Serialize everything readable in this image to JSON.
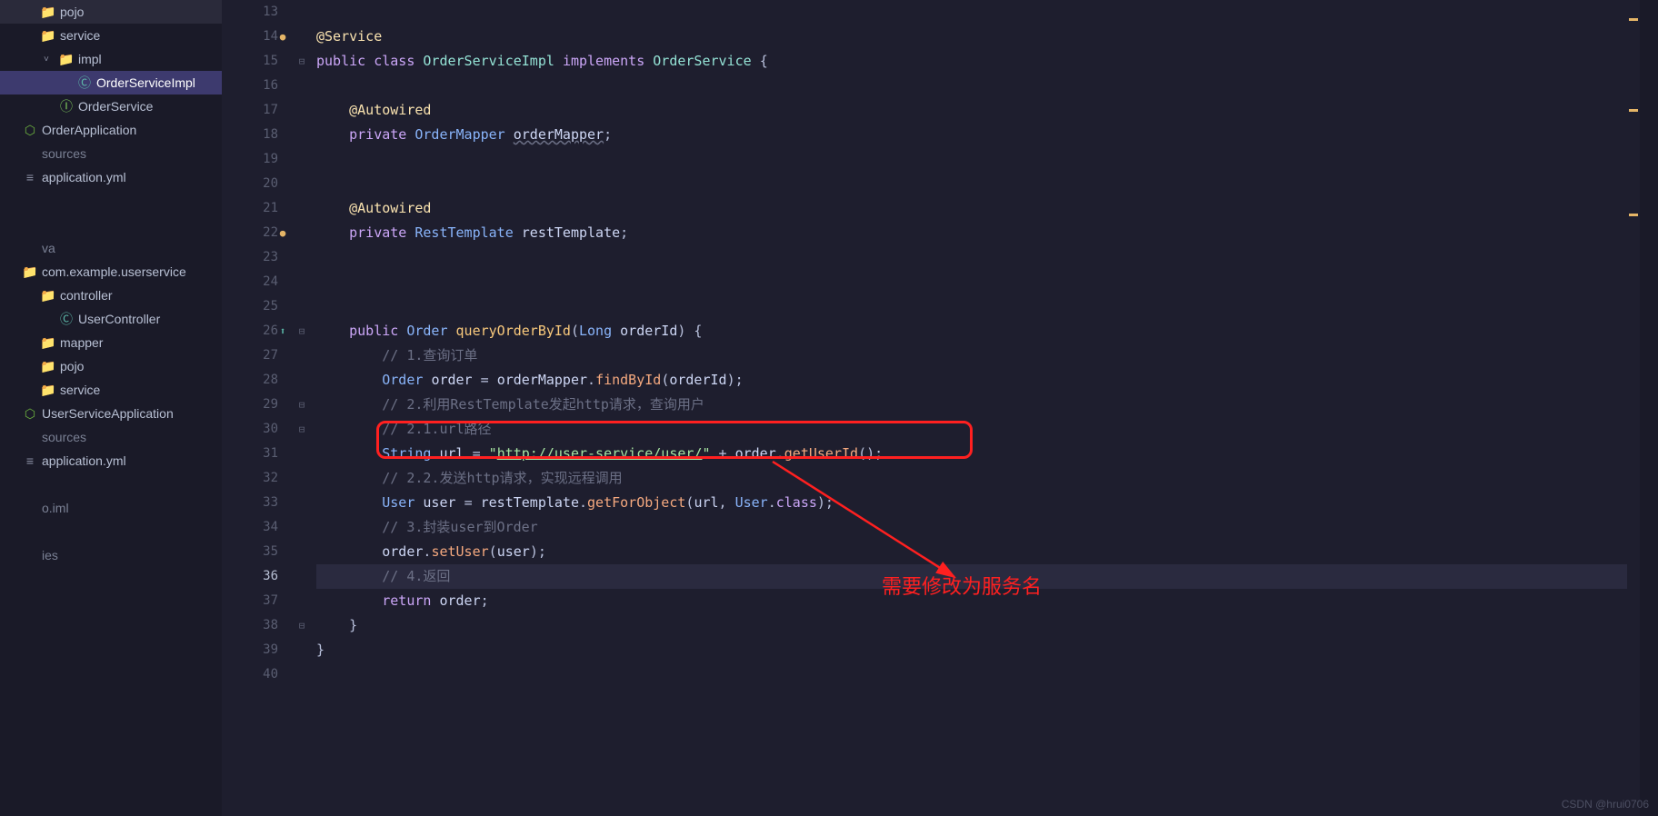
{
  "sidebar": {
    "items": [
      {
        "indent": "pad-1",
        "arrow": "",
        "iconClass": "icon-folder",
        "icon": "📁",
        "label": "pojo"
      },
      {
        "indent": "pad-1",
        "arrow": "",
        "iconClass": "icon-folder-blue",
        "icon": "📁",
        "label": "service"
      },
      {
        "indent": "pad-2",
        "arrow": "˅",
        "iconClass": "icon-folder",
        "icon": "📁",
        "label": "impl"
      },
      {
        "indent": "pad-3",
        "arrow": "",
        "iconClass": "icon-class",
        "icon": "Ⓒ",
        "label": "OrderServiceImpl",
        "selected": true
      },
      {
        "indent": "pad-2",
        "arrow": "",
        "iconClass": "icon-interface",
        "icon": "Ⓘ",
        "label": "OrderService"
      },
      {
        "indent": "",
        "arrow": "",
        "iconClass": "icon-spring",
        "icon": "⬡",
        "label": "OrderApplication"
      },
      {
        "indent": "",
        "arrow": "",
        "iconClass": "",
        "icon": "",
        "label": "sources",
        "dim": true
      },
      {
        "indent": "",
        "arrow": "",
        "iconClass": "icon-yml",
        "icon": "≡",
        "label": "application.yml"
      },
      {
        "indent": "",
        "arrow": "",
        "iconClass": "",
        "icon": "",
        "label": "",
        "dim": true
      },
      {
        "indent": "",
        "arrow": "",
        "iconClass": "",
        "icon": "",
        "label": "",
        "dim": true
      },
      {
        "indent": "",
        "arrow": "",
        "iconClass": "",
        "icon": "",
        "label": "va",
        "dim": true
      },
      {
        "indent": "",
        "arrow": "",
        "iconClass": "icon-folder",
        "icon": "📁",
        "label": "com.example.userservice"
      },
      {
        "indent": "pad-1",
        "arrow": "",
        "iconClass": "icon-folder-blue",
        "icon": "📁",
        "label": "controller"
      },
      {
        "indent": "pad-2",
        "arrow": "",
        "iconClass": "icon-class",
        "icon": "Ⓒ",
        "label": "UserController"
      },
      {
        "indent": "pad-1",
        "arrow": "",
        "iconClass": "icon-folder",
        "icon": "📁",
        "label": "mapper"
      },
      {
        "indent": "pad-1",
        "arrow": "",
        "iconClass": "icon-folder",
        "icon": "📁",
        "label": "pojo"
      },
      {
        "indent": "pad-1",
        "arrow": "",
        "iconClass": "icon-folder-blue",
        "icon": "📁",
        "label": "service"
      },
      {
        "indent": "",
        "arrow": "",
        "iconClass": "icon-spring",
        "icon": "⬡",
        "label": "UserServiceApplication"
      },
      {
        "indent": "",
        "arrow": "",
        "iconClass": "",
        "icon": "",
        "label": "sources",
        "dim": true
      },
      {
        "indent": "",
        "arrow": "",
        "iconClass": "icon-yml",
        "icon": "≡",
        "label": "application.yml"
      },
      {
        "indent": "",
        "arrow": "",
        "iconClass": "",
        "icon": "",
        "label": "",
        "dim": true
      },
      {
        "indent": "",
        "arrow": "",
        "iconClass": "",
        "icon": "",
        "label": "o.iml",
        "dim": true
      },
      {
        "indent": "",
        "arrow": "",
        "iconClass": "",
        "icon": "",
        "label": "",
        "dim": true
      },
      {
        "indent": "",
        "arrow": "",
        "iconClass": "",
        "icon": "",
        "label": "ies",
        "dim": true
      }
    ]
  },
  "gutter": {
    "start": 13,
    "end": 40,
    "current": 36,
    "marks": {
      "14": "bean",
      "22": "bean",
      "26": "override"
    }
  },
  "code": [
    {
      "n": 13,
      "html": ""
    },
    {
      "n": 14,
      "html": "<span class='ann'>@Service</span>"
    },
    {
      "n": 15,
      "html": "<span class='kw'>public</span> <span class='kw'>class</span> <span class='cls'>OrderServiceImpl</span> <span class='kw'>implements</span> <span class='cls'>OrderService</span> <span class='punct'>{</span>"
    },
    {
      "n": 16,
      "html": ""
    },
    {
      "n": 17,
      "html": "    <span class='ann'>@Autowired</span>"
    },
    {
      "n": 18,
      "html": "    <span class='kw'>private</span> <span class='type'>OrderMapper</span> <span class='ident underline'>orderMapper</span><span class='punct'>;</span>"
    },
    {
      "n": 19,
      "html": ""
    },
    {
      "n": 20,
      "html": ""
    },
    {
      "n": 21,
      "html": "    <span class='ann'>@Autowired</span>"
    },
    {
      "n": 22,
      "html": "    <span class='kw'>private</span> <span class='type'>RestTemplate</span> <span class='ident'>restTemplate</span><span class='punct'>;</span>"
    },
    {
      "n": 23,
      "html": ""
    },
    {
      "n": 24,
      "html": ""
    },
    {
      "n": 25,
      "html": ""
    },
    {
      "n": 26,
      "html": "    <span class='kw'>public</span> <span class='type'>Order</span> <span class='fn'>queryOrderById</span><span class='punct'>(</span><span class='type'>Long</span> <span class='ident'>orderId</span><span class='punct'>) {</span>"
    },
    {
      "n": 27,
      "html": "        <span class='cmt'>// 1.查询订单</span>"
    },
    {
      "n": 28,
      "html": "        <span class='type'>Order</span> <span class='ident'>order</span> <span class='punct'>=</span> <span class='ident'>orderMapper</span><span class='punct'>.</span><span class='fn2'>findById</span><span class='punct'>(</span><span class='ident'>orderId</span><span class='punct'>);</span>"
    },
    {
      "n": 29,
      "html": "        <span class='cmt'>// 2.利用RestTemplate发起http请求，查询用户</span>"
    },
    {
      "n": 30,
      "html": "        <span class='cmt'>// 2.1.url路径</span>"
    },
    {
      "n": 31,
      "html": "        <span class='type'>String</span> <span class='ident'>url</span> <span class='punct'>=</span> <span class='str'>\"<span class='link-under'>http://user-service/user/</span>\"</span> <span class='punct'>+</span> <span class='ident'>order</span><span class='punct'>.</span><span class='fn2'>getUserId</span><span class='punct'>();</span>"
    },
    {
      "n": 32,
      "html": "        <span class='cmt'>// 2.2.发送http请求，实现远程调用</span>"
    },
    {
      "n": 33,
      "html": "        <span class='type'>User</span> <span class='ident'>user</span> <span class='punct'>=</span> <span class='ident'>restTemplate</span><span class='punct'>.</span><span class='fn2'>getForObject</span><span class='punct'>(</span><span class='ident'>url</span><span class='punct'>,</span> <span class='type'>User</span><span class='punct'>.</span><span class='kw'>class</span><span class='punct'>);</span>"
    },
    {
      "n": 34,
      "html": "        <span class='cmt'>// 3.封装user到Order</span>"
    },
    {
      "n": 35,
      "html": "        <span class='ident'>order</span><span class='punct'>.</span><span class='fn2'>setUser</span><span class='punct'>(</span><span class='ident'>user</span><span class='punct'>);</span>"
    },
    {
      "n": 36,
      "html": "        <span class='cmt'>// 4.返回</span>",
      "current": true
    },
    {
      "n": 37,
      "html": "        <span class='kw'>return</span> <span class='ident'>order</span><span class='punct'>;</span>"
    },
    {
      "n": 38,
      "html": "    <span class='punct'>}</span>"
    },
    {
      "n": 39,
      "html": "<span class='punct'>}</span>"
    },
    {
      "n": 40,
      "html": ""
    }
  ],
  "annotation": {
    "text": "需要修改为服务名"
  },
  "watermark": "CSDN @hrui0706"
}
